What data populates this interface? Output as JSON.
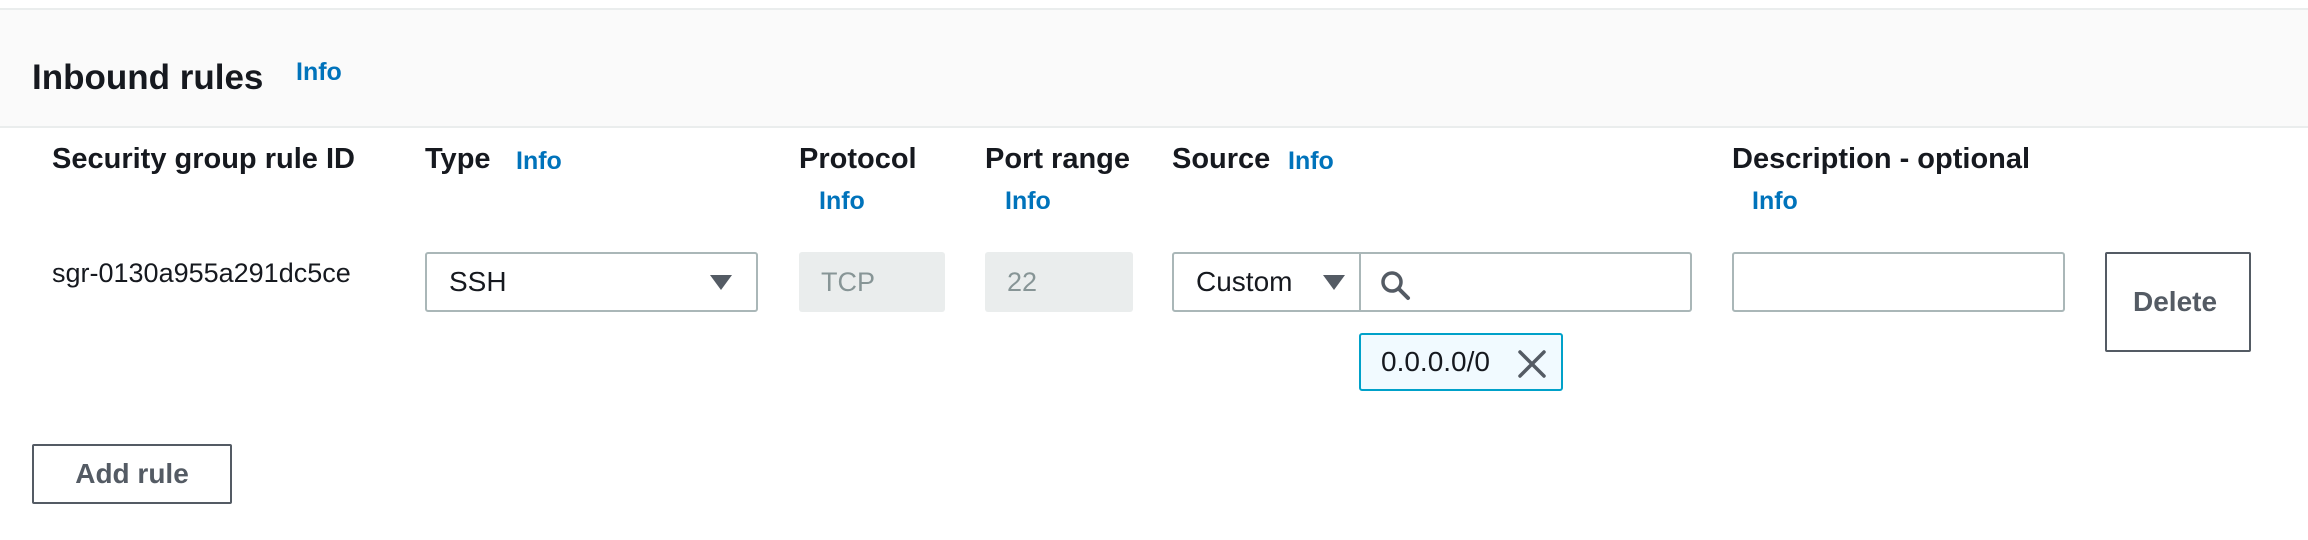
{
  "panel": {
    "title": "Inbound rules",
    "info": "Info"
  },
  "columns": {
    "rule_id": "Security group rule ID",
    "type": "Type",
    "protocol": "Protocol",
    "port_range": "Port range",
    "source": "Source",
    "description": "Description - optional",
    "info": "Info"
  },
  "rule": {
    "id": "sgr-0130a955a291dc5ce",
    "type_value": "SSH",
    "protocol_value": "TCP",
    "port_value": "22",
    "source_mode": "Custom",
    "source_token": "0.0.0.0/0",
    "description_value": "",
    "delete_label": "Delete"
  },
  "actions": {
    "add_rule_label": "Add rule"
  },
  "colors": {
    "link": "#0073bb",
    "token_border": "#00a1c9",
    "border": "#aab7b8"
  }
}
